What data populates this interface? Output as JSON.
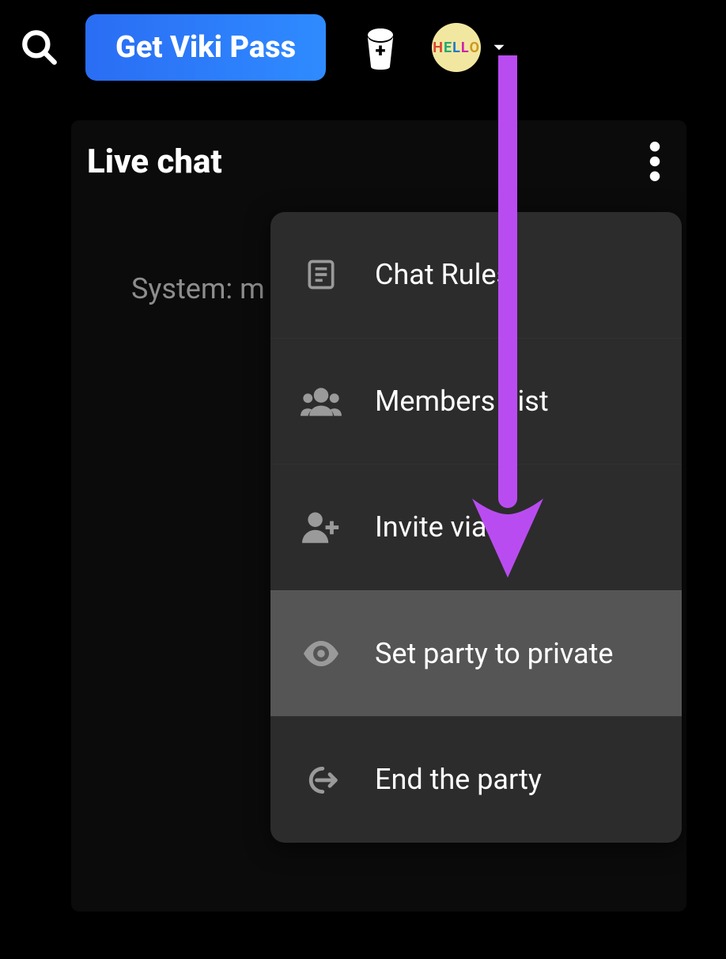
{
  "topbar": {
    "pass_label": "Get Viki Pass",
    "avatar_text": "HELLO"
  },
  "chat": {
    "title": "Live chat",
    "system_message": "System: m"
  },
  "menu": {
    "items": [
      {
        "label": "Chat Rules"
      },
      {
        "label": "Members List"
      },
      {
        "label": "Invite via ..."
      },
      {
        "label": "Set party to private"
      },
      {
        "label": "End the party"
      }
    ]
  },
  "annotation": {
    "arrow_color": "#b94cf0"
  }
}
